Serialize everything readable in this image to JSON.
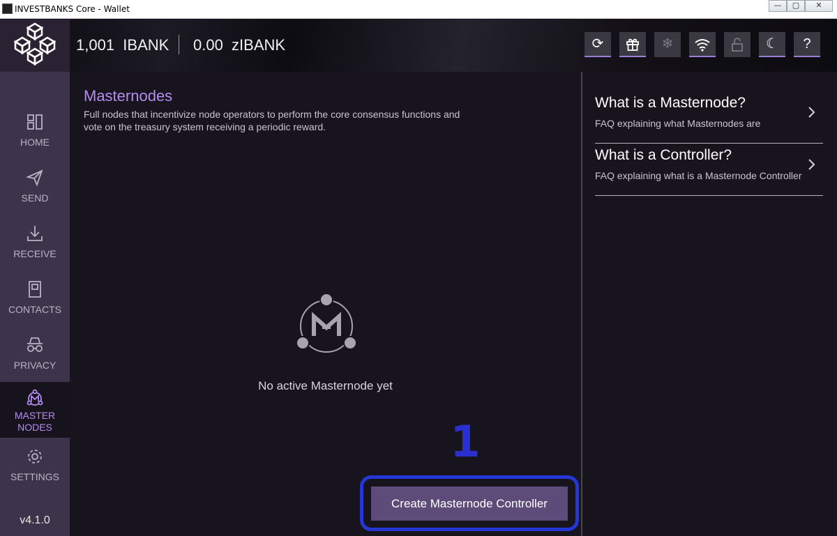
{
  "window": {
    "title": "INVESTBANKS Core - Wallet",
    "controls": [
      "—",
      "▢",
      "✕"
    ]
  },
  "header": {
    "balance_ibank": "1,001  IBANK",
    "balance_zibank": "0.00  zIBANK",
    "buttons": [
      {
        "icon": "sync-icon",
        "glyph": "⟳"
      },
      {
        "icon": "gift-icon",
        "glyph": "🎁"
      },
      {
        "icon": "snowflake-icon",
        "glyph": "❄"
      },
      {
        "icon": "wifi-icon",
        "glyph": "⌔"
      },
      {
        "icon": "lock-icon",
        "glyph": "🔓"
      },
      {
        "icon": "moon-icon",
        "glyph": "☾"
      },
      {
        "icon": "help-icon",
        "glyph": "?"
      }
    ]
  },
  "sidebar": {
    "items": [
      {
        "label": "HOME",
        "icon": "home-icon"
      },
      {
        "label": "SEND",
        "icon": "send-icon"
      },
      {
        "label": "RECEIVE",
        "icon": "receive-icon"
      },
      {
        "label": "CONTACTS",
        "icon": "contacts-icon"
      },
      {
        "label": "PRIVACY",
        "icon": "privacy-icon"
      },
      {
        "label_line1": "MASTER",
        "label_line2": "NODES",
        "icon": "masternodes-icon",
        "active": true
      },
      {
        "label": "SETTINGS",
        "icon": "settings-icon"
      }
    ],
    "version": "v4.1.0"
  },
  "main": {
    "title": "Masternodes",
    "description": "Full nodes that incentivize node operators to perform the core consensus functions and vote on the treasury system receiving a periodic reward.",
    "empty_text": "No active Masternode yet",
    "annotation_number": "1",
    "create_button": "Create Masternode Controller"
  },
  "faq": [
    {
      "question": "What is a Masternode?",
      "answer": "FAQ explaining what Masternodes are"
    },
    {
      "question": "What is a Controller?",
      "answer": "FAQ explaining what is a Masternode Controller"
    }
  ],
  "colors": {
    "accent": "#b38cf0",
    "button": "#5d4b7a",
    "sidebar": "#3d334a",
    "background": "#18141e",
    "highlight": "#2436d6"
  }
}
